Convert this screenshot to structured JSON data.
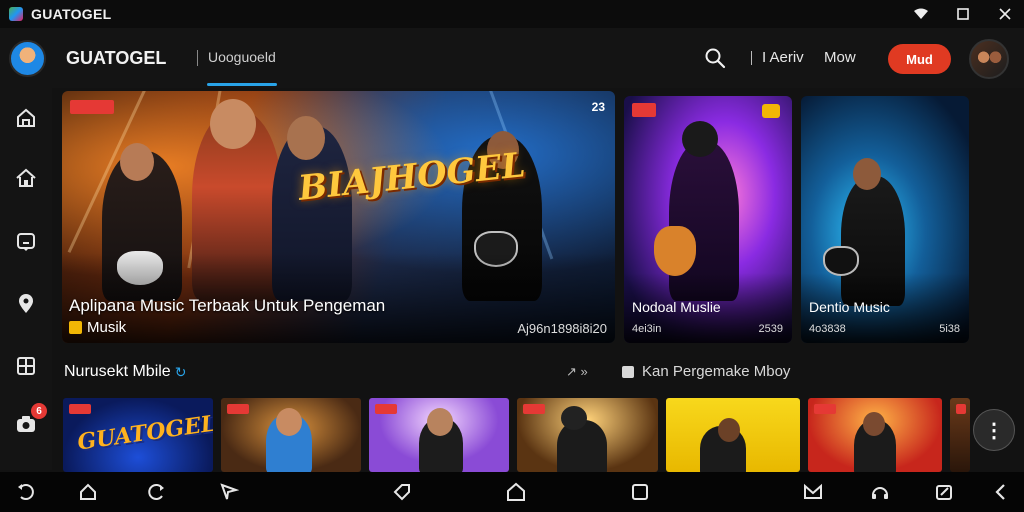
{
  "window": {
    "title": "GUATOGEL",
    "controls": [
      "wifi-icon",
      "maximize-icon",
      "close-icon"
    ]
  },
  "header": {
    "brand": "GUATOGEL",
    "active_tab": "Uooguoeld",
    "nav": [
      "I Aeriv",
      "Mow"
    ],
    "cta": "Mud",
    "accent": "#29a3e8",
    "cta_color": "#e03a22"
  },
  "sidebar": {
    "items": [
      "home-icon",
      "house-icon",
      "message-icon",
      "location-icon",
      "grid-icon",
      "camera-icon"
    ],
    "badge": "6"
  },
  "hero": {
    "logo": "BIAJHOGEL",
    "corner_number": "23",
    "title": "Aplipana Music Terbaak Untuk Pengeman",
    "category": "Musik",
    "count": "Aj96n1898i8i20"
  },
  "cards": [
    {
      "title": "Nodoal Muslie",
      "meta_left": "4ei3in",
      "meta_right": "2539"
    },
    {
      "title": "Dentio Music",
      "meta_left": "4o3838",
      "meta_right": "5i38"
    }
  ],
  "section": {
    "title": "Nurusekt Mbile",
    "arrow": "↗ »",
    "right_label": "Kan Pergemake Mboy"
  },
  "thumbnails": [
    {
      "logo": "GUATOGEL"
    },
    {},
    {},
    {},
    {},
    {},
    {}
  ],
  "system_nav": [
    "back-icon",
    "home-outline-icon",
    "refresh-icon",
    "send-icon",
    "tag-icon",
    "home-icon",
    "square-icon",
    "mail-icon",
    "headset-icon",
    "edit-icon",
    "chevron-left-icon"
  ]
}
